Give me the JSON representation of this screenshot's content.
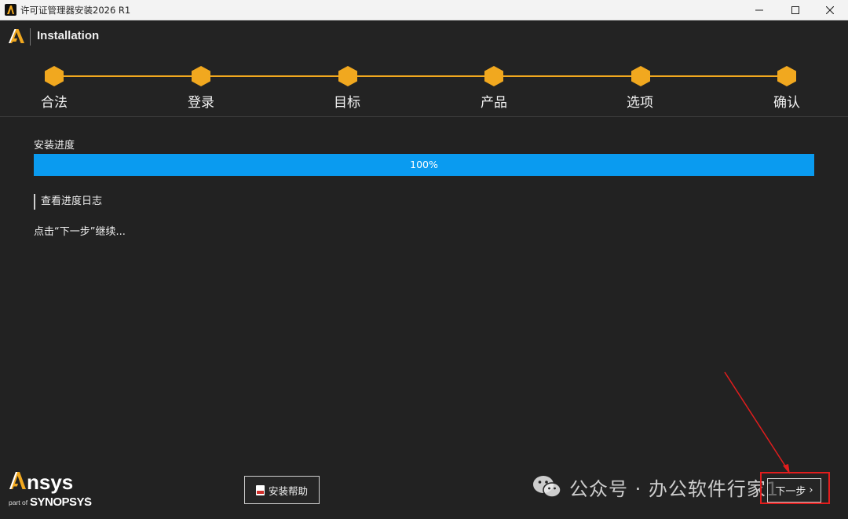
{
  "window": {
    "title": "许可证管理器安装2026 R1",
    "controls": {
      "minimize": "—",
      "maximize": "☐",
      "close": "✕"
    }
  },
  "header": {
    "title": "Installation"
  },
  "steps": [
    {
      "label": "合法"
    },
    {
      "label": "登录"
    },
    {
      "label": "目标"
    },
    {
      "label": "产品"
    },
    {
      "label": "选项"
    },
    {
      "label": "确认"
    }
  ],
  "main": {
    "progress_label": "安装进度",
    "progress_value": 1.0,
    "progress_text": "100%",
    "log_link": "查看进度日志",
    "hint": "点击“下一步”继续..."
  },
  "footer": {
    "help_label": "安装帮助",
    "next_label": "下一步",
    "next_chevron": "›",
    "watermark": "公众号 · 办公软件行家1"
  },
  "colors": {
    "accent": "#f1a81f",
    "progress": "#0a9bf0",
    "background": "#222222",
    "highlight": "#e11d1d"
  }
}
